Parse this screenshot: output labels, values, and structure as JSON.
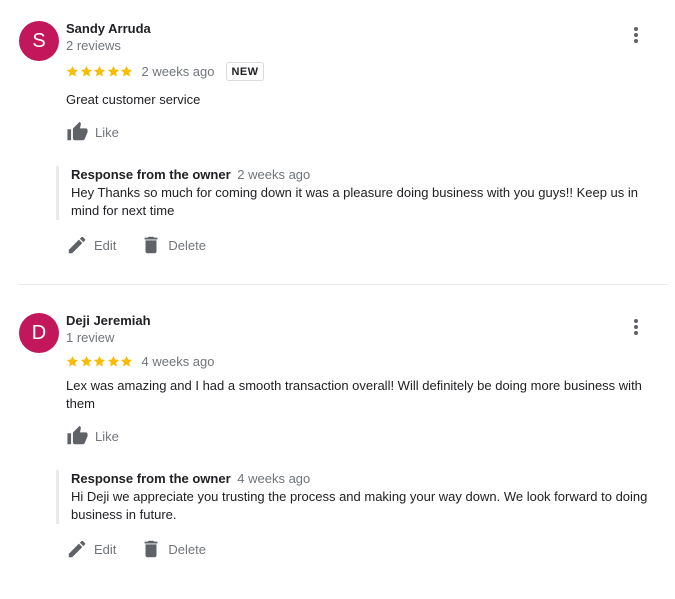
{
  "colors": {
    "avatar_bg": "#c2185b",
    "star": "#fbbc04",
    "icon": "#5f6368"
  },
  "reviews": [
    {
      "avatar_letter": "S",
      "name": "Sandy Arruda",
      "review_count": "2 reviews",
      "rating": 5,
      "time": "2 weeks ago",
      "badge": "NEW",
      "text": "Great customer service",
      "like_label": "Like",
      "response": {
        "label": "Response from the owner",
        "time": "2 weeks ago",
        "text": "Hey Thanks so much for coming down it was a pleasure doing business with you guys!! Keep us in mind for next time"
      },
      "edit_label": "Edit",
      "delete_label": "Delete"
    },
    {
      "avatar_letter": "D",
      "name": "Deji Jeremiah",
      "review_count": "1 review",
      "rating": 5,
      "time": "4 weeks ago",
      "text": "Lex was amazing and I had a smooth transaction overall! Will definitely be doing more business with them",
      "like_label": "Like",
      "response": {
        "label": "Response from the owner",
        "time": "4 weeks ago",
        "text": "Hi Deji we appreciate you trusting the process and making your way down. We look forward to doing business in future."
      },
      "edit_label": "Edit",
      "delete_label": "Delete"
    }
  ]
}
